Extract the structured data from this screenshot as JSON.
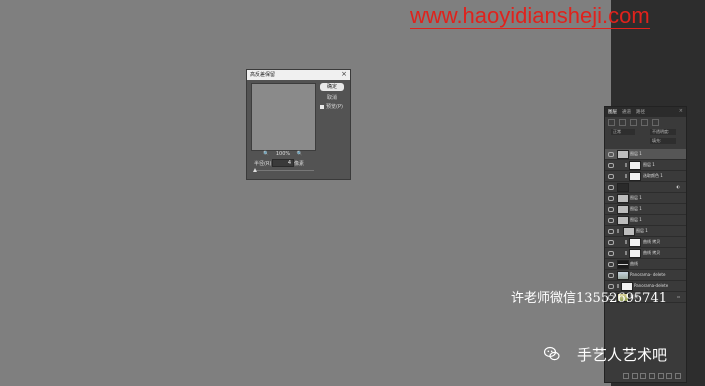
{
  "watermark": {
    "url": "www.haoyidiansheji.com"
  },
  "dialog": {
    "title": "高反差保留",
    "close": "×",
    "ok_label": "确定",
    "cancel_label": "取消",
    "preview_label": "预览(P)",
    "zoom_out": "🔍",
    "zoom_level": "100%",
    "zoom_in": "🔍",
    "radius_label": "半径(R):",
    "radius_value": "4",
    "radius_unit": "像素"
  },
  "layers_panel": {
    "tabs": [
      "图层",
      "通道",
      "路径"
    ],
    "close": "×",
    "blend_mode": "正常",
    "opacity_label": "不透明度:",
    "fill_label": "填充:",
    "layers": [
      {
        "name": "图层 1",
        "selected": true
      },
      {
        "name": "图层 1"
      },
      {
        "name": "选取颜色 1"
      },
      {
        "name": ""
      },
      {
        "name": "图层 1"
      },
      {
        "name": "图层 1"
      },
      {
        "name": "图层 1"
      },
      {
        "name": "图层 1"
      },
      {
        "name": "曲线 拷贝"
      },
      {
        "name": "曲线 拷贝"
      },
      {
        "name": "曲线"
      },
      {
        "name": "Panorama- delete"
      },
      {
        "name": "Panorama-delete"
      },
      {
        "name": "背景"
      }
    ]
  },
  "overlay": {
    "wechat_id": "许老师微信13552695741",
    "account_name": "手艺人艺术吧"
  },
  "colors": {
    "watermark": "#e0221c",
    "canvas": "#7f7f7f",
    "panel": "#3a3a3a"
  }
}
